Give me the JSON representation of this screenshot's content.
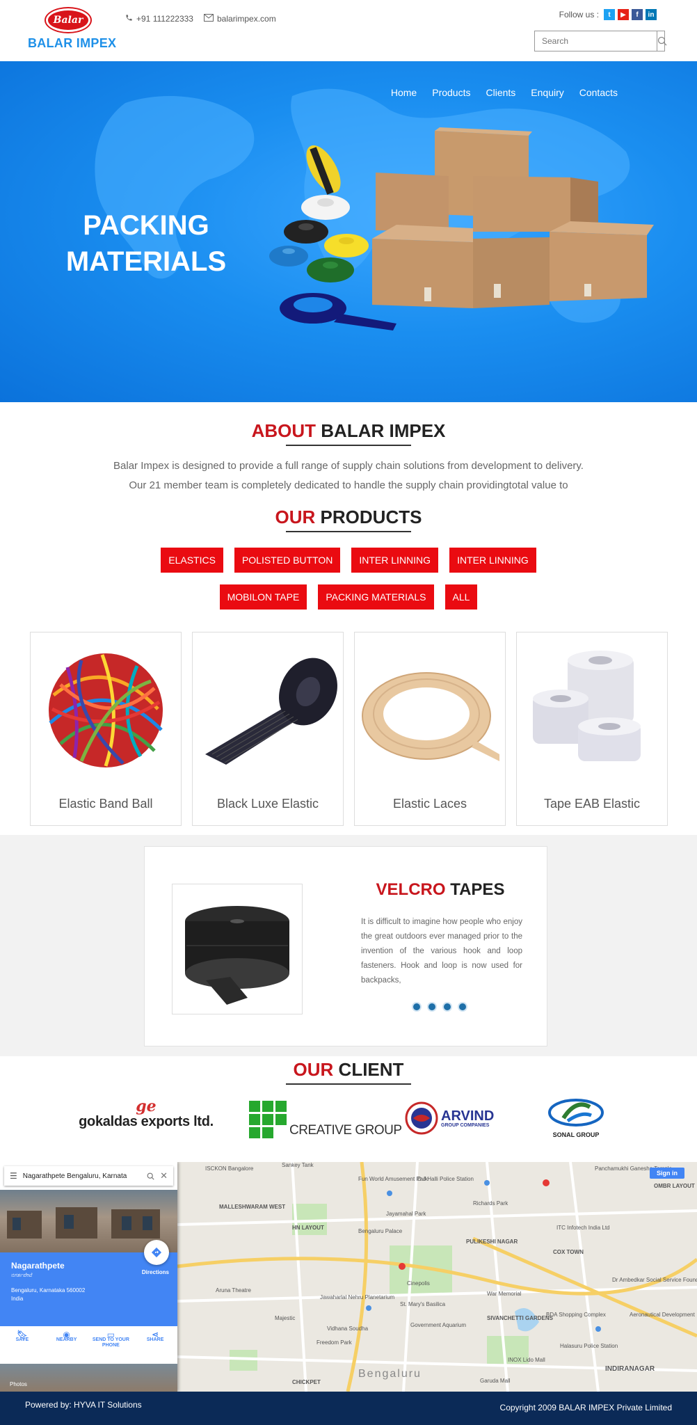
{
  "header": {
    "logo_text": "Balar",
    "brand_name": "BALAR IMPEX",
    "phone": "+91 111222333",
    "email": "balarimpex.com",
    "follow_label": "Follow us :",
    "search_placeholder": "Search"
  },
  "colors": {
    "brand_red": "#c8161d",
    "tab_red": "#ea0b11",
    "hero_blue": "#1a8ef0",
    "footer_navy": "#0b2a57"
  },
  "nav": [
    "Home",
    "Products",
    "Clients",
    "Enquiry",
    "Contacts"
  ],
  "hero": {
    "line1": "PACKING",
    "line2": "MATERIALS"
  },
  "about": {
    "title_red": "ABOUT",
    "title_rest": " BALAR IMPEX",
    "line1": "Balar Impex is designed to provide a full range of supply chain solutions from development to delivery.",
    "line2": "Our 21 member team is completely dedicated to handle the supply chain providingtotal value to"
  },
  "products": {
    "title_red": "OUR",
    "title_rest": " PRODUCTS",
    "tabs_row1": [
      "ELASTICS",
      "POLISTED BUTTON",
      "INTER LINNING",
      "INTER LINNING"
    ],
    "tabs_row2": [
      "MOBILON TAPE",
      "PACKING MATERIALS",
      "ALL"
    ],
    "items": [
      "Elastic Band Ball",
      "Black Luxe Elastic",
      "Elastic Laces",
      "Tape EAB Elastic"
    ]
  },
  "feature": {
    "title_red": "VELCRO",
    "title_rest": " TAPES",
    "text": "It is difficult to imagine how people who enjoy the great outdoors ever managed prior to the invention of the various hook and loop fasteners. Hook and loop is now used for backpacks,"
  },
  "clients": {
    "title_red": "OUR",
    "title_rest": " CLIENT",
    "gokaldas": "gokaldas exports ltd.",
    "creative": "CREATIVE GROUP",
    "arvind": "ARVIND",
    "arvind_sub": "GROUP COMPANIES",
    "sonal": "SONAL GROUP"
  },
  "map": {
    "search_value": "Nagarathpete Bengaluru, Karnata",
    "place_name": "Nagarathpete",
    "place_local": "ನಗರ್ತಪೇಟೆ",
    "address1": "Bengaluru, Karnataka 560002",
    "address2": "India",
    "directions": "Directions",
    "actions": [
      "SAVE",
      "NEARBY",
      "SEND TO YOUR PHONE",
      "SHARE"
    ],
    "photos": "Photos",
    "sign_in": "Sign in",
    "labels": {
      "l1": "ISCKON Bangalore",
      "l2": "Sankey Tank",
      "l3": "Fun World Amusement Park",
      "l4": "D J Halli Police Station",
      "l5": "Panchamukhi Ganesha Temple",
      "l6": "MALLESHWARAM WEST",
      "l7": "Jayamahal Park",
      "l8": "Richards Park",
      "l9": "HN LAYOUT",
      "l10": "Bengaluru Palace",
      "l11": "ITC Infotech India Ltd",
      "l12": "PULIKESHI NAGAR",
      "l13": "COX TOWN",
      "l14": "Cinepolis",
      "l15": "War Memorial",
      "l16": "Dr Ambedkar Social Service Foundation",
      "l17": "Jawaharlal Nehru Planetarium",
      "l18": "St. Mary's Basilica",
      "l19": "SIVANCHETTI GARDENS",
      "l20": "Government Aquarium",
      "l21": "BDA Shopping Complex",
      "l22": "Freedom Park",
      "l23": "Vidhana Soudha",
      "l24": "Aeronautical Development",
      "l25": "Halasuru Police Station",
      "l26": "INDIRANAGAR",
      "l27": "CHICKPET",
      "l28": "Bengaluru",
      "l29": "Garuda Mall",
      "l30": "INOX Lido Mall",
      "l31": "Majestic",
      "l32": "Aruna Theatre",
      "l33": "OMBR LAYOUT"
    }
  },
  "footer": {
    "powered": "Powered by: HYVA IT Solutions",
    "copyright": "Copyright 2009 BALAR IMPEX Private Limited"
  }
}
